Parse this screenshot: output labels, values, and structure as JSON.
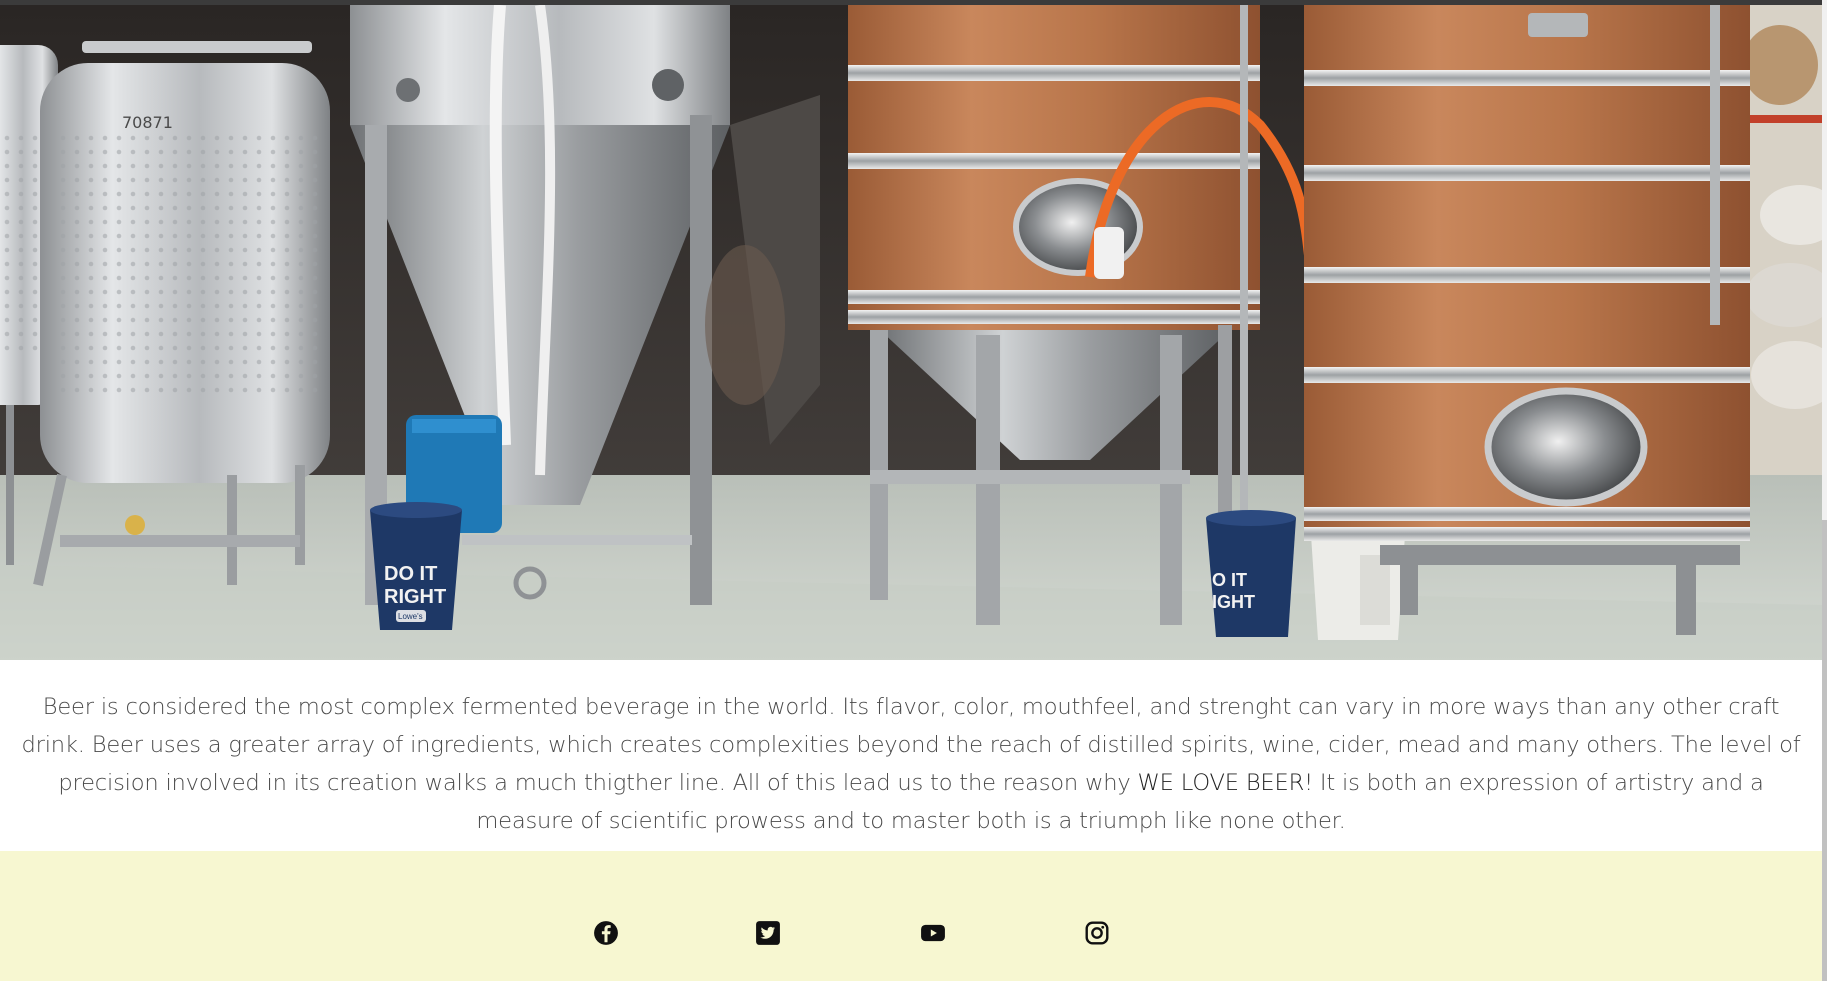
{
  "hero": {
    "tank_number": "70871",
    "bucket_left_lines": [
      "DO IT",
      "RIGHT"
    ],
    "bucket_left_brand": "Lowe's",
    "bucket_mid_lines": [
      "O IT",
      "IGHT"
    ]
  },
  "intro": {
    "text_before": "Beer is considered the most complex fermented beverage in the world. Its flavor, color, mouthfeel, and strenght can vary in more ways than any other craft drink. Beer uses a greater array of ingredients, which creates complexities beyond the reach of distilled spirits, wine, cider, mead and many others. The level of precision involved in its creation walks a much thigther line. All of this lead us to the reason why ",
    "emphasis": "WE LOVE BEER!",
    "text_after": " It is both an expression of artistry and a measure of scientific prowess and to master both is a triumph like none other."
  },
  "footer": {
    "background": "#f7f7d1",
    "social_links": [
      {
        "name": "facebook",
        "icon": "facebook-icon"
      },
      {
        "name": "twitter",
        "icon": "twitter-icon"
      },
      {
        "name": "youtube",
        "icon": "youtube-icon"
      },
      {
        "name": "instagram",
        "icon": "instagram-icon"
      }
    ]
  }
}
